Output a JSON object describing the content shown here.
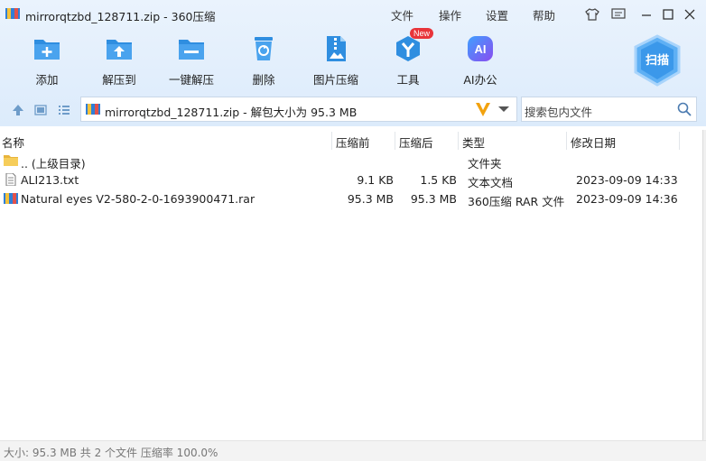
{
  "window": {
    "title": "mirrorqtzbd_128711.zip - 360压缩",
    "menu": [
      "文件",
      "操作",
      "设置",
      "帮助"
    ]
  },
  "toolbar": {
    "items": [
      {
        "label": "添加",
        "icon": "add-icon"
      },
      {
        "label": "解压到",
        "icon": "extract-to-icon"
      },
      {
        "label": "一键解压",
        "icon": "one-click-extract-icon"
      },
      {
        "label": "删除",
        "icon": "delete-icon"
      },
      {
        "label": "图片压缩",
        "icon": "image-compress-icon"
      },
      {
        "label": "工具",
        "icon": "tools-icon",
        "badge": "New"
      },
      {
        "label": "AI办公",
        "icon": "ai-office-icon",
        "icon_text": "AI"
      }
    ],
    "scan_label": "扫描"
  },
  "address": {
    "path": "mirrorqtzbd_128711.zip - 解包大小为 95.3 MB",
    "search_placeholder": "搜索包内文件"
  },
  "columns": {
    "name": "名称",
    "compressed_before": "压缩前",
    "compressed_after": "压缩后",
    "type": "类型",
    "modified": "修改日期"
  },
  "files": [
    {
      "name": ".. (上级目录)",
      "before": "",
      "after": "",
      "type": "文件夹",
      "modified": "",
      "icon": "folder-icon"
    },
    {
      "name": "ALI213.txt",
      "before": "9.1 KB",
      "after": "1.5 KB",
      "type": "文本文档",
      "modified": "2023-09-09 14:33",
      "icon": "text-file-icon"
    },
    {
      "name": "Natural eyes V2-580-2-0-1693900471.rar",
      "before": "95.3 MB",
      "after": "95.3 MB",
      "type": "360压缩 RAR 文件",
      "modified": "2023-09-09 14:36",
      "icon": "rar-archive-icon"
    }
  ],
  "status": "大小: 95.3 MB 共 2 个文件 压缩率 100.0%",
  "colors": {
    "toolbar_bg": "#dcebfb",
    "icon_blue": "#2f8ee0",
    "badge_red": "#e8343a",
    "ai_purple": "#6a5cf0"
  }
}
